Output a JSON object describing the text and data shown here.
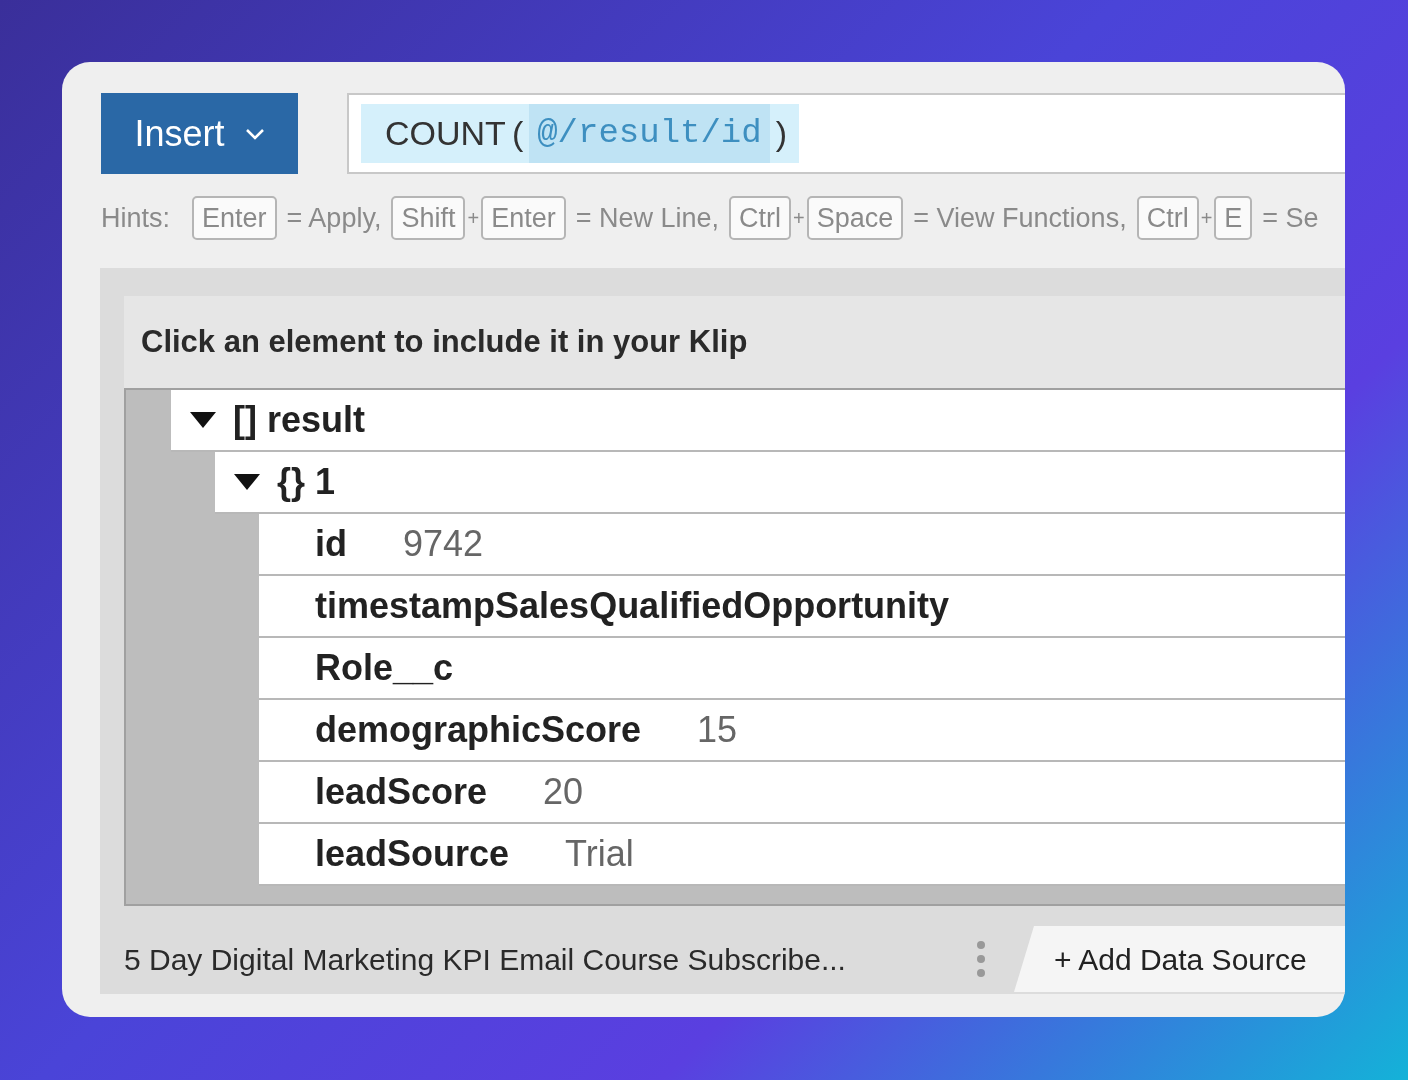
{
  "insert_button": {
    "label": "Insert"
  },
  "formula": {
    "function": "COUNT",
    "open": "(",
    "argument": "@/result/id",
    "close": ")"
  },
  "hints": {
    "label": "Hints:",
    "items": [
      {
        "kind": "key",
        "text": "Enter"
      },
      {
        "kind": "text",
        "text": "= Apply,"
      },
      {
        "kind": "key",
        "text": "Shift"
      },
      {
        "kind": "joiner",
        "text": "+"
      },
      {
        "kind": "key",
        "text": "Enter"
      },
      {
        "kind": "text",
        "text": "= New Line,"
      },
      {
        "kind": "key",
        "text": "Ctrl"
      },
      {
        "kind": "joiner",
        "text": "+"
      },
      {
        "kind": "key",
        "text": "Space"
      },
      {
        "kind": "text",
        "text": "= View Functions,"
      },
      {
        "kind": "key",
        "text": "Ctrl"
      },
      {
        "kind": "joiner",
        "text": "+"
      },
      {
        "kind": "key",
        "text": "E"
      },
      {
        "kind": "text",
        "text": "= Se"
      }
    ]
  },
  "tree": {
    "title": "Click an element to include it in your Klip",
    "nodes": [
      {
        "icon": "[]",
        "label": "result",
        "expanded": true,
        "children": [
          {
            "icon": "{}",
            "label": "1",
            "expanded": true,
            "children": [
              {
                "label": "id",
                "value": "9742"
              },
              {
                "label": "timestampSalesQualifiedOpportunity"
              },
              {
                "label": "Role__c"
              },
              {
                "label": "demographicScore",
                "value": "15"
              },
              {
                "label": "leadScore",
                "value": "20"
              },
              {
                "label": "leadSource",
                "value": "Trial"
              }
            ]
          }
        ]
      }
    ]
  },
  "footer": {
    "source": "5 Day Digital Marketing KPI Email Course Subscribe...",
    "add_button": "+ Add Data Source"
  }
}
